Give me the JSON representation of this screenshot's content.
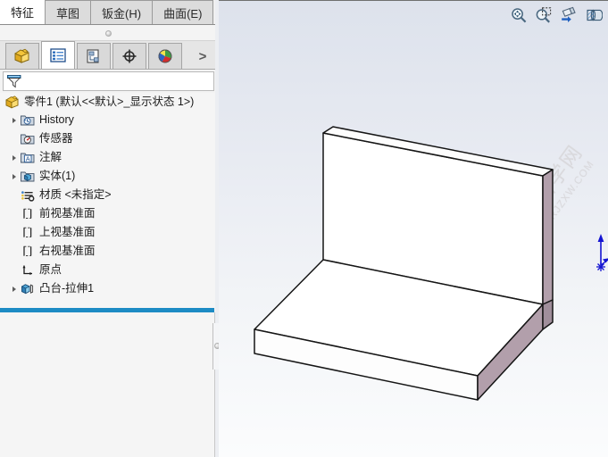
{
  "command_tabs": [
    {
      "label": "特征",
      "active": true
    },
    {
      "label": "草图",
      "active": false
    },
    {
      "label": "钣金(H)",
      "active": false
    },
    {
      "label": "曲面(E)",
      "active": false
    }
  ],
  "manager_tabs": [
    {
      "name": "feature-manager-design-tree",
      "icon": "yellow-part-icon",
      "active": false
    },
    {
      "name": "property-manager",
      "icon": "property-list-icon",
      "active": true
    },
    {
      "name": "configuration-manager",
      "icon": "configuration-icon",
      "active": false
    },
    {
      "name": "dimxpert-manager",
      "icon": "crosshair-target-icon",
      "active": false
    },
    {
      "name": "display-manager",
      "icon": "color-sphere-icon",
      "active": false
    },
    {
      "name": "more-tabs",
      "icon": "chevron-right-icon",
      "label": ">",
      "active": false
    }
  ],
  "filter": {
    "icon": "funnel-filter-icon",
    "value": "",
    "placeholder": ""
  },
  "tree": {
    "root": {
      "label": "零件1  (默认<<默认>_显示状态 1>)",
      "icon": "yellow-part-icon",
      "expandable": false
    },
    "items": [
      {
        "label": "History",
        "icon": "history-icon",
        "expandable": true
      },
      {
        "label": "传感器",
        "icon": "sensor-icon",
        "expandable": false
      },
      {
        "label": "注解",
        "icon": "annotation-icon",
        "expandable": true
      },
      {
        "label": "实体(1)",
        "icon": "solid-bodies-icon",
        "expandable": true
      },
      {
        "label": "材质 <未指定>",
        "icon": "material-icon",
        "expandable": false
      },
      {
        "label": "前视基准面",
        "icon": "plane-icon",
        "expandable": false
      },
      {
        "label": "上视基准面",
        "icon": "plane-icon",
        "expandable": false
      },
      {
        "label": "右视基准面",
        "icon": "plane-icon",
        "expandable": false
      },
      {
        "label": "原点",
        "icon": "origin-icon",
        "expandable": false
      },
      {
        "label": "凸台-拉伸1",
        "icon": "boss-extrude-icon",
        "expandable": true
      }
    ],
    "rollback_bar_color": "#1d8bc4"
  },
  "view_toolbar": {
    "buttons": [
      {
        "name": "zoom-to-fit-button",
        "icon": "magnifier-fit-icon"
      },
      {
        "name": "zoom-to-area-button",
        "icon": "magnifier-area-icon"
      },
      {
        "name": "view-orientation-button",
        "icon": "flashlight-arrow-icon"
      },
      {
        "name": "section-view-button",
        "icon": "section-cylinder-icon"
      }
    ]
  },
  "graphics": {
    "watermark_main": "软件自学网",
    "watermark_sub": "WWW.RJZXW.COM",
    "origin_marker": "origin-triad-blue",
    "model_name": "L-bracket-part",
    "colors": {
      "face_light": "#ffffff",
      "face_shade": "#fdfdfd",
      "side_face": "#b29fab",
      "side_face_dark": "#a08e9b",
      "edge": "#1a1a1a",
      "origin": "#1414d2",
      "background_top": "#dde2ec",
      "background_bottom": "#fbfcfd"
    }
  }
}
